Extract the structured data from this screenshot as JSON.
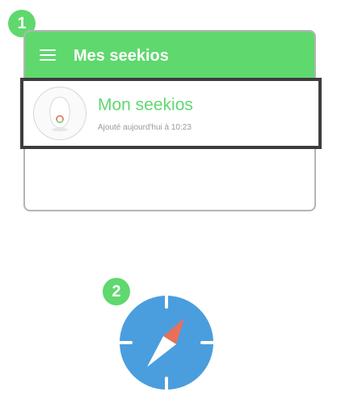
{
  "badges": {
    "step1": "1",
    "step2": "2"
  },
  "app_bar": {
    "title": "Mes seekios",
    "menu_icon": "hamburger-menu-icon"
  },
  "list": {
    "items": [
      {
        "name": "Mon seekios",
        "subtitle": "Ajouté aujourd'hui à 10:23",
        "avatar": "seekios-device-image"
      }
    ]
  },
  "colors": {
    "accent_green": "#5fd86e",
    "frame_dark": "#3d3d3d",
    "compass_blue": "#4a9ede",
    "compass_red": "#e8705a"
  },
  "icons": {
    "compass": "compass-icon"
  }
}
